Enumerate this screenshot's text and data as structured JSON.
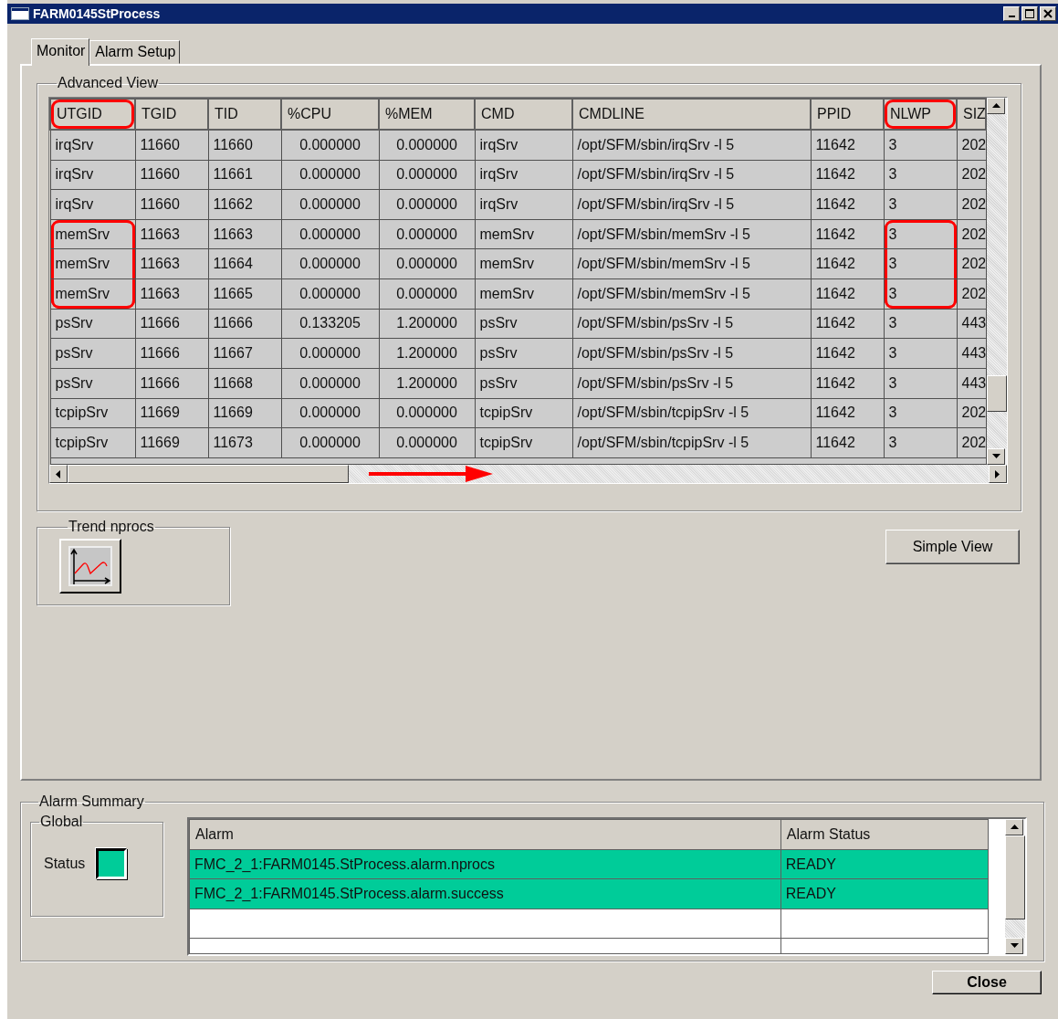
{
  "window": {
    "title": "FARM0145StProcess"
  },
  "tabs": [
    {
      "label": "Monitor",
      "selected": true
    },
    {
      "label": "Alarm Setup",
      "selected": false
    }
  ],
  "advanced_view": {
    "title": "Advanced View",
    "table": {
      "columns": [
        {
          "label": "UTGID",
          "circled": true
        },
        {
          "label": "TGID",
          "circled": false
        },
        {
          "label": "TID",
          "circled": false
        },
        {
          "label": "%CPU",
          "circled": false
        },
        {
          "label": "%MEM",
          "circled": false
        },
        {
          "label": "CMD",
          "circled": false
        },
        {
          "label": "CMDLINE",
          "circled": false
        },
        {
          "label": "PPID",
          "circled": false
        },
        {
          "label": "NLWP",
          "circled": true
        },
        {
          "label": "SIZ",
          "circled": false
        }
      ],
      "rows": [
        {
          "marked": false,
          "cells": [
            "irqSrv",
            "11660",
            "11660",
            "0.000000",
            "0.000000",
            "irqSrv",
            "/opt/SFM/sbin/irqSrv -l 5",
            "11642",
            "3",
            "202"
          ]
        },
        {
          "marked": false,
          "cells": [
            "irqSrv",
            "11660",
            "11661",
            "0.000000",
            "0.000000",
            "irqSrv",
            "/opt/SFM/sbin/irqSrv -l 5",
            "11642",
            "3",
            "202"
          ]
        },
        {
          "marked": false,
          "cells": [
            "irqSrv",
            "11660",
            "11662",
            "0.000000",
            "0.000000",
            "irqSrv",
            "/opt/SFM/sbin/irqSrv -l 5",
            "11642",
            "3",
            "202"
          ]
        },
        {
          "marked": true,
          "cells": [
            "memSrv",
            "11663",
            "11663",
            "0.000000",
            "0.000000",
            "memSrv",
            "/opt/SFM/sbin/memSrv -l 5",
            "11642",
            "3",
            "202"
          ]
        },
        {
          "marked": true,
          "cells": [
            "memSrv",
            "11663",
            "11664",
            "0.000000",
            "0.000000",
            "memSrv",
            "/opt/SFM/sbin/memSrv -l 5",
            "11642",
            "3",
            "202"
          ]
        },
        {
          "marked": true,
          "cells": [
            "memSrv",
            "11663",
            "11665",
            "0.000000",
            "0.000000",
            "memSrv",
            "/opt/SFM/sbin/memSrv -l 5",
            "11642",
            "3",
            "202"
          ]
        },
        {
          "marked": false,
          "cells": [
            "psSrv",
            "11666",
            "11666",
            "0.133205",
            "1.200000",
            "psSrv",
            "/opt/SFM/sbin/psSrv -l 5",
            "11642",
            "3",
            "443"
          ]
        },
        {
          "marked": false,
          "cells": [
            "psSrv",
            "11666",
            "11667",
            "0.000000",
            "1.200000",
            "psSrv",
            "/opt/SFM/sbin/psSrv -l 5",
            "11642",
            "3",
            "443"
          ]
        },
        {
          "marked": false,
          "cells": [
            "psSrv",
            "11666",
            "11668",
            "0.000000",
            "1.200000",
            "psSrv",
            "/opt/SFM/sbin/psSrv -l 5",
            "11642",
            "3",
            "443"
          ]
        },
        {
          "marked": false,
          "cells": [
            "tcpipSrv",
            "11669",
            "11669",
            "0.000000",
            "0.000000",
            "tcpipSrv",
            "/opt/SFM/sbin/tcpipSrv -l 5",
            "11642",
            "3",
            "202"
          ]
        },
        {
          "marked": false,
          "cells": [
            "tcpipSrv",
            "11669",
            "11673",
            "0.000000",
            "0.000000",
            "tcpipSrv",
            "/opt/SFM/sbin/tcpipSrv -l 5",
            "11642",
            "3",
            "202"
          ]
        }
      ]
    }
  },
  "trend": {
    "title": "Trend nprocs"
  },
  "simple_view_button": {
    "label": "Simple View"
  },
  "alarm_summary": {
    "title": "Alarm Summary",
    "global": {
      "title": "Global",
      "status_label": "Status",
      "color": "#00cc99"
    },
    "columns": [
      "Alarm",
      "Alarm Status"
    ],
    "rows": [
      {
        "alarm": "FMC_2_1:FARM0145.StProcess.alarm.nprocs",
        "status": "READY",
        "color": "#00cc99"
      },
      {
        "alarm": "FMC_2_1:FARM0145.StProcess.alarm.success",
        "status": "READY",
        "color": "#00cc99"
      }
    ]
  },
  "close_button": {
    "label": "Close"
  }
}
